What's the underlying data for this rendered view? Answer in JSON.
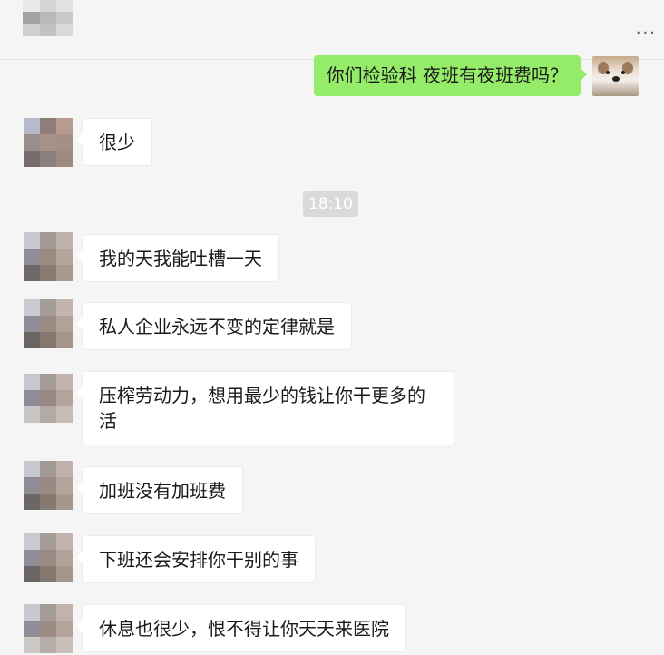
{
  "header": {
    "more_label": "···"
  },
  "sent_message": {
    "text": "你们检验科 夜班有夜班费吗？"
  },
  "timestamp": "18:10",
  "messages": [
    {
      "text": "很少"
    },
    {
      "text": "我的天我能吐槽一天"
    },
    {
      "text": "私人企业永远不变的定律就是"
    },
    {
      "text": "压榨劳动力，想用最少的钱让你干更多的\n活"
    },
    {
      "text": "加班没有加班费"
    },
    {
      "text": "下班还会安排你干别的事"
    },
    {
      "text": "休息也很少，恨不得让你天天来医院"
    }
  ],
  "colors": {
    "sent_bubble": "#95ec69",
    "received_bubble": "#ffffff",
    "background": "#f5f5f5"
  }
}
